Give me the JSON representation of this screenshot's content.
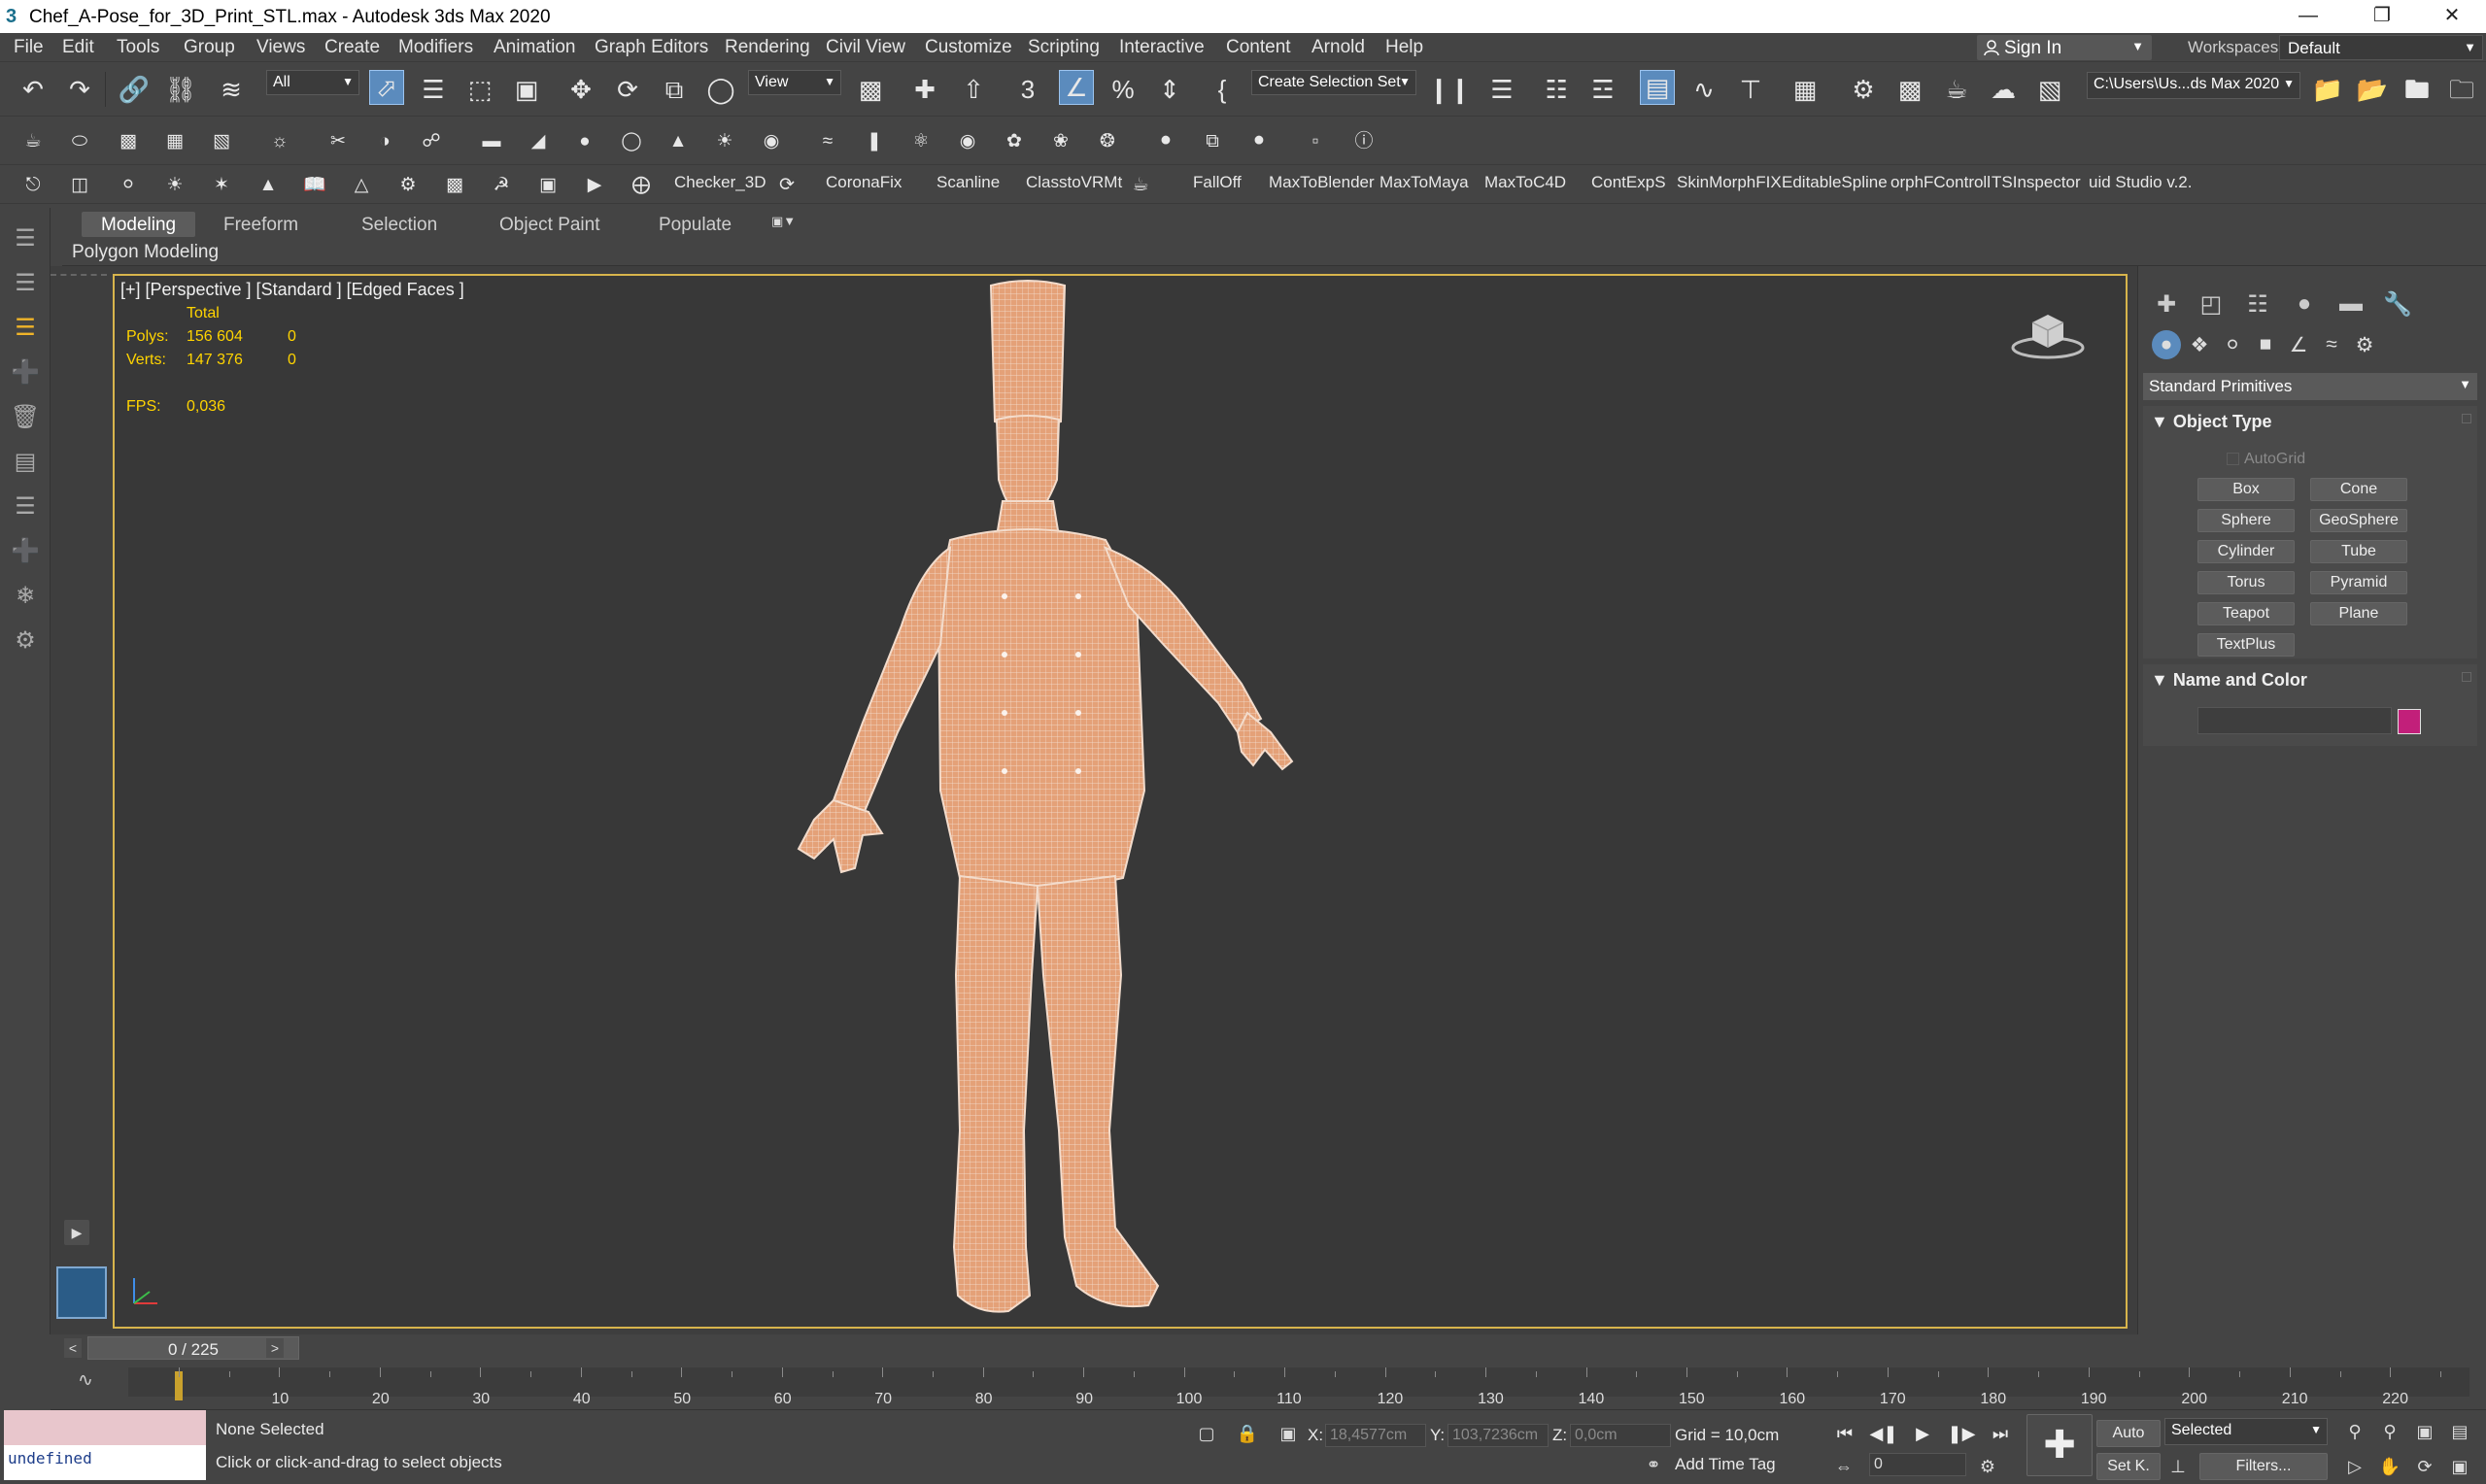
{
  "window": {
    "title": "Chef_A-Pose_for_3D_Print_STL.max - Autodesk 3ds Max 2020",
    "minimize_icon": "minimize-icon",
    "maximize_icon": "restore-icon",
    "close_icon": "close-icon"
  },
  "menubar": {
    "items": [
      "File",
      "Edit",
      "Tools",
      "Group",
      "Views",
      "Create",
      "Modifiers",
      "Animation",
      "Graph Editors",
      "Rendering",
      "Civil View",
      "Customize",
      "Scripting",
      "Interactive",
      "Content",
      "Arnold",
      "Help"
    ],
    "sign_in": "Sign In",
    "workspaces_label": "Workspaces:",
    "workspaces_value": "Default"
  },
  "toolbar": {
    "selection_filter": "All",
    "reference_coord": "View",
    "named_selection": "Create Selection Set",
    "project_path": "C:\\Users\\Us...ds Max 2020"
  },
  "plugins": {
    "items": [
      "Checker_3D",
      "CoronaFix",
      "Scanline",
      "ClasstoVRMt",
      "FallOff",
      "MaxToBlender",
      "MaxToMaya",
      "MaxToC4D",
      "ContExpS",
      "SkinMorphFIX",
      "EditableSpline",
      "orphFControll",
      "TSInspector",
      "uid Studio v.2."
    ]
  },
  "ribbon": {
    "tabs": [
      "Modeling",
      "Freeform",
      "Selection",
      "Object Paint",
      "Populate"
    ],
    "active_tab": "Modeling",
    "panel_label": "Polygon Modeling"
  },
  "viewport": {
    "label": "[+] [Perspective ] [Standard ] [Edged Faces ]",
    "stats_header": "Total",
    "polys_label": "Polys:",
    "polys_total": "156 604",
    "polys_selected": "0",
    "verts_label": "Verts:",
    "verts_total": "147 376",
    "verts_selected": "0",
    "fps_label": "FPS:",
    "fps_value": "0,036",
    "model_fill": "#e8a174",
    "border_color": "#d7b44c"
  },
  "command_panel": {
    "category": "Standard Primitives",
    "object_type_title": "Object Type",
    "autogrid": "AutoGrid",
    "primitives": [
      "Box",
      "Cone",
      "Sphere",
      "GeoSphere",
      "Cylinder",
      "Tube",
      "Torus",
      "Pyramid",
      "Teapot",
      "Plane",
      "TextPlus"
    ],
    "name_color_title": "Name and Color",
    "object_name": "",
    "object_color": "#c21f7a"
  },
  "timeline": {
    "time_slider": "0 / 225",
    "prev": "<",
    "next": ">",
    "ticks": [
      "10",
      "20",
      "30",
      "40",
      "50",
      "60",
      "70",
      "80",
      "90",
      "100",
      "110",
      "120",
      "130",
      "140",
      "150",
      "160",
      "170",
      "180",
      "190",
      "200",
      "210",
      "220"
    ],
    "current_frame": 0,
    "total_frames": 225
  },
  "statusbar": {
    "maxscript_output": "undefined",
    "selection_status": "None Selected",
    "prompt": "Click or click-and-drag to select objects",
    "x_label": "X:",
    "x_value": "18,4577cm",
    "y_label": "Y:",
    "y_value": "103,7236cm",
    "z_label": "Z:",
    "z_value": "0,0cm",
    "grid": "Grid = 10,0cm",
    "add_time_tag": "Add Time Tag",
    "auto_key": "Auto",
    "set_key": "Set K.",
    "key_filter": "Selected",
    "filters": "Filters...",
    "frame_field": "0"
  }
}
